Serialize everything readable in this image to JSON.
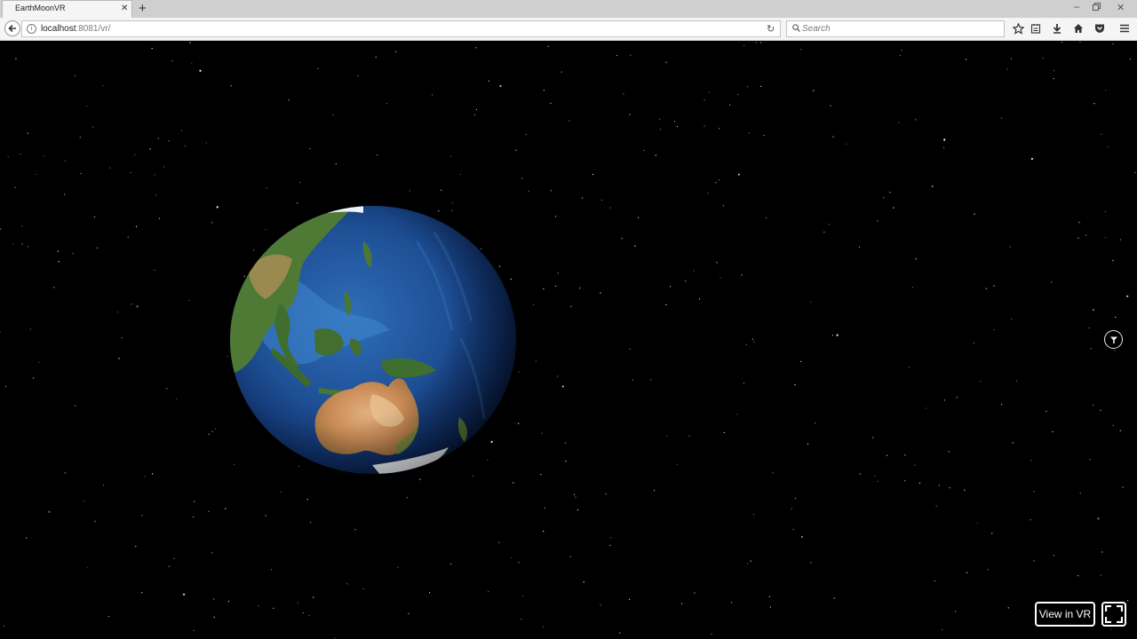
{
  "browser": {
    "tab_title": "EarthMoonVR",
    "tab_close_icon": "close-icon",
    "new_tab_icon": "plus-icon",
    "url_host": "localhost",
    "url_path": ":8081/vr/",
    "search_placeholder": "Search",
    "toolbar_icons": [
      "star-icon",
      "reading-list-icon",
      "download-icon",
      "home-icon",
      "pocket-icon",
      "menu-icon"
    ],
    "window_controls": [
      "minimize-icon",
      "restore-icon",
      "close-icon"
    ]
  },
  "scene": {
    "background_color": "#000000",
    "vr_button_label": "View in VR",
    "fullscreen_icon": "fullscreen-icon",
    "cursor_icon": "gaze-cursor-icon"
  }
}
